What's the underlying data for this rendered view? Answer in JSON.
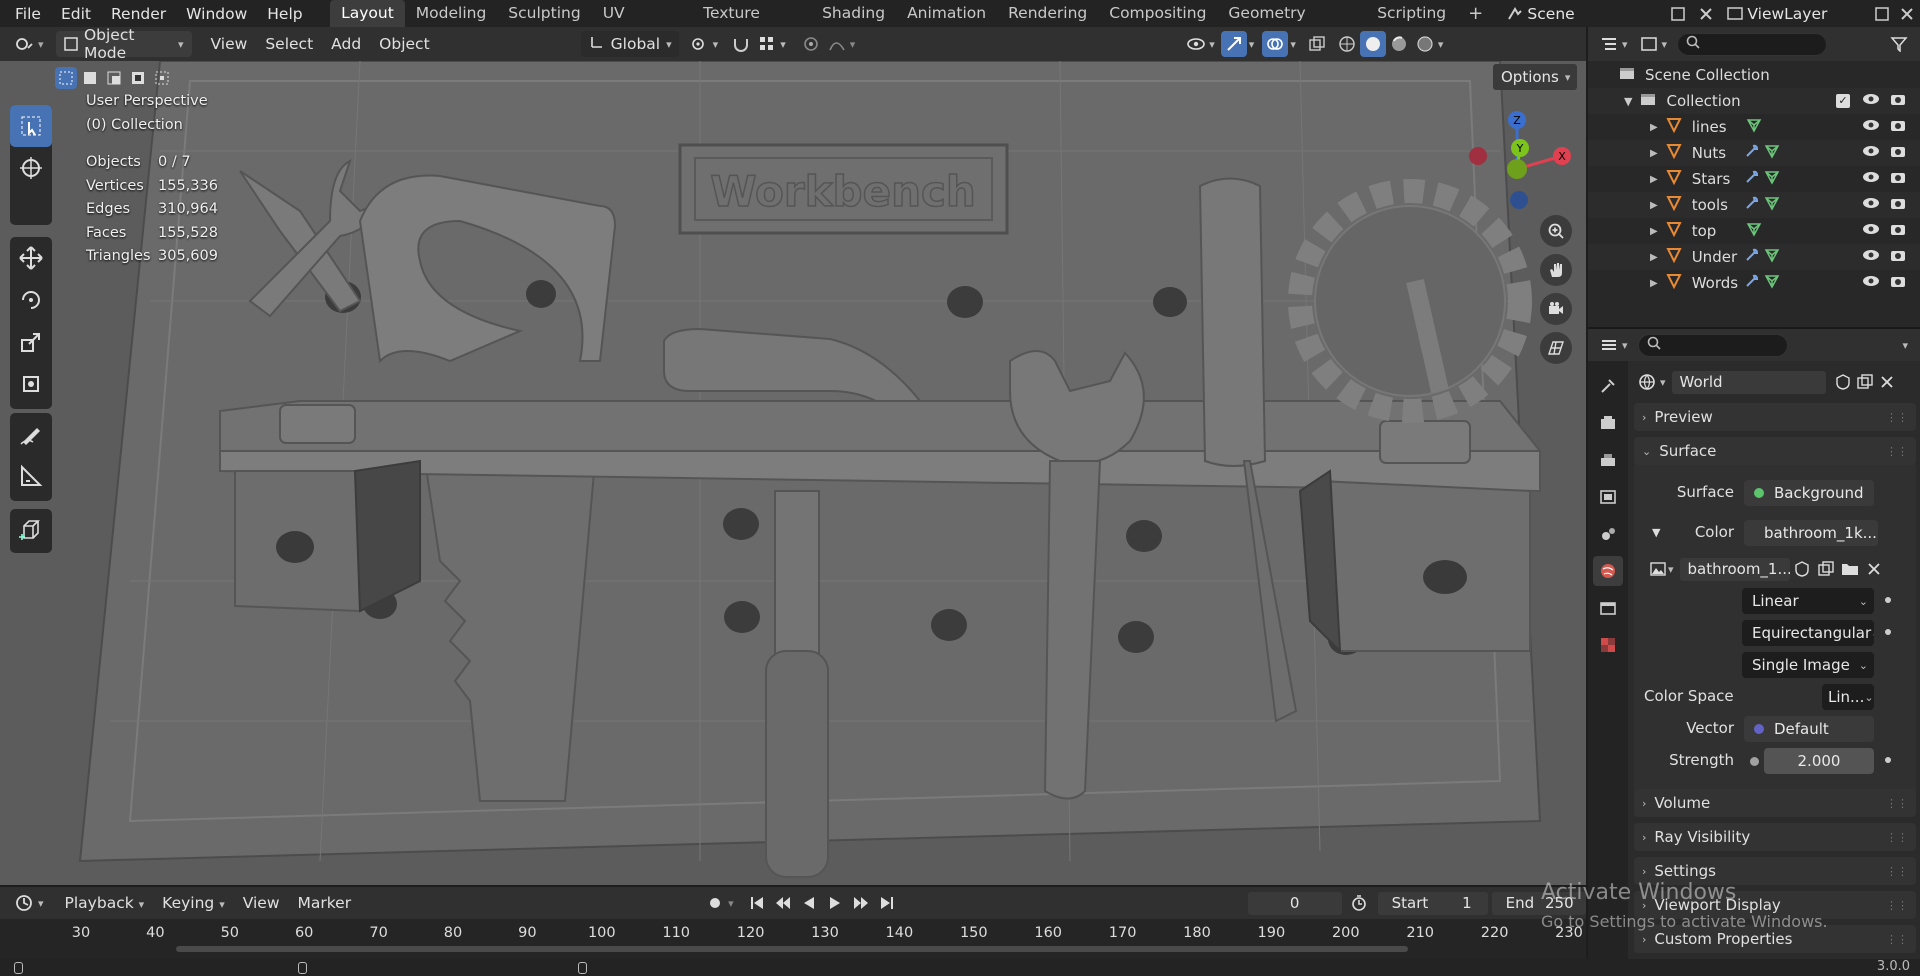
{
  "topbar": {
    "menus": [
      "File",
      "Edit",
      "Render",
      "Window",
      "Help"
    ],
    "workspaces": [
      "Layout",
      "Modeling",
      "Sculpting",
      "UV Editing",
      "Texture Paint",
      "Shading",
      "Animation",
      "Rendering",
      "Compositing",
      "Geometry Nodes",
      "Scripting"
    ],
    "add_tab": "+",
    "scene": "Scene",
    "view_layer": "ViewLayer"
  },
  "viewport_header": {
    "mode": "Object Mode",
    "menus": [
      "View",
      "Select",
      "Add",
      "Object"
    ],
    "orientation": "Global",
    "options": "Options"
  },
  "viewport": {
    "perspective": "User Perspective",
    "collection": "(0) Collection",
    "stats": [
      {
        "label": "Objects",
        "value": "0 / 7"
      },
      {
        "label": "Vertices",
        "value": "155,336"
      },
      {
        "label": "Edges",
        "value": "310,964"
      },
      {
        "label": "Faces",
        "value": "155,528"
      },
      {
        "label": "Triangles",
        "value": "305,609"
      }
    ],
    "sign_text": "Workbench",
    "gizmo": {
      "z": "Z",
      "y": "Y",
      "x": "X"
    }
  },
  "outliner": {
    "scene_collection": "Scene Collection",
    "collection": "Collection",
    "items": [
      {
        "name": "lines",
        "mod": false
      },
      {
        "name": "Nuts",
        "mod": true
      },
      {
        "name": "Stars",
        "mod": true
      },
      {
        "name": "tools",
        "mod": true
      },
      {
        "name": "top",
        "mod": false
      },
      {
        "name": "Under",
        "mod": true
      },
      {
        "name": "Words",
        "mod": true
      }
    ]
  },
  "properties": {
    "world_name": "World",
    "panels": {
      "preview": "Preview",
      "surface": "Surface",
      "volume": "Volume",
      "ray_visibility": "Ray Visibility",
      "settings": "Settings",
      "viewport_display": "Viewport Display",
      "custom_properties": "Custom Properties"
    },
    "surface_label": "Surface",
    "surface_value": "Background",
    "color_label": "Color",
    "color_value": "bathroom_1k....",
    "image_name": "bathroom_1...",
    "interpolation": "Linear",
    "projection": "Equirectangular",
    "source": "Single Image",
    "color_space_label": "Color Space",
    "color_space_value": "Lin...",
    "vector_label": "Vector",
    "vector_value": "Default",
    "strength_label": "Strength",
    "strength_value": "2.000"
  },
  "timeline": {
    "menus": [
      "Playback",
      "Keying",
      "View",
      "Marker"
    ],
    "current_frame": "0",
    "start_label": "Start",
    "start_value": "1",
    "end_label": "End",
    "end_value": "250",
    "ruler_ticks": [
      "30",
      "40",
      "50",
      "60",
      "70",
      "80",
      "90",
      "100",
      "110",
      "120",
      "130",
      "140",
      "150",
      "160",
      "170",
      "180",
      "190",
      "200",
      "210",
      "220",
      "230"
    ]
  },
  "watermark": {
    "line1": "Activate Windows",
    "line2": "Go to Settings to activate Windows."
  },
  "statusbar": {
    "version": "3.0.0"
  },
  "colors": {
    "accent": "#4772b3",
    "object_orange": "#e88934",
    "mesh_green": "#6cc47a",
    "modifier_blue": "#7aa6e8"
  }
}
